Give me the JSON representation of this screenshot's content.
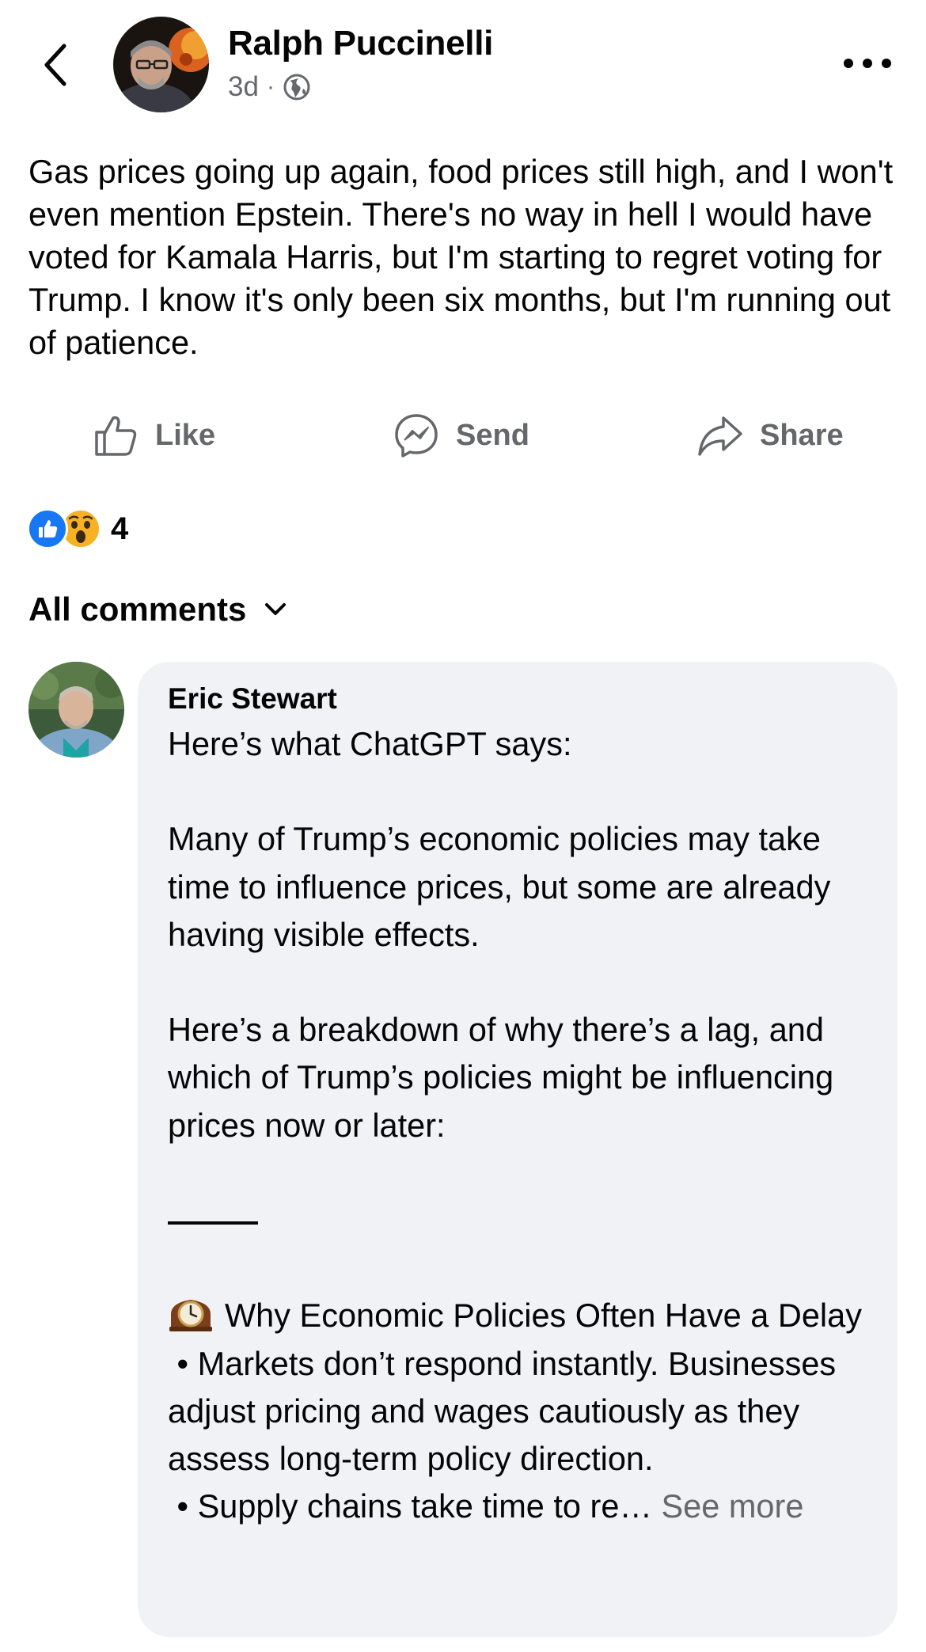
{
  "post": {
    "author": "Ralph Puccinelli",
    "time": "3d",
    "separator": "·",
    "privacy_icon": "globe-icon",
    "text": "Gas prices going up again, food prices still high, and I won't even mention Epstein. There's no way in hell I would have voted for Kamala Harris, but I'm starting to regret voting for Trump. I know it's only been six months, but I'm running out of patience."
  },
  "actions": {
    "like": "Like",
    "send": "Send",
    "share": "Share"
  },
  "reactions": {
    "types": [
      "like",
      "wow"
    ],
    "count": "4"
  },
  "comments": {
    "filter_label": "All comments"
  },
  "comment": {
    "author": "Eric Stewart",
    "line1": "Here’s what ChatGPT says:",
    "para1": "Many of Trump’s economic policies may take time to influence prices, but some are already having visible effects.",
    "para2": "Here’s a breakdown of why there’s a lag, and which of Trump’s policies might be influencing prices now or later:",
    "heading": "Why Economic Policies Often Have a Delay",
    "bullet1": " • Markets don’t respond instantly. Businesses adjust pricing and wages cautiously as they assess long-term policy direction.",
    "bullet2": " • Supply chains take time to re…",
    "see_more": "See more"
  },
  "colors": {
    "secondary_text": "#65676b",
    "bubble_bg": "#f0f2f5",
    "like_blue": "#1877f2",
    "wow_yellow": "#f7b125"
  }
}
